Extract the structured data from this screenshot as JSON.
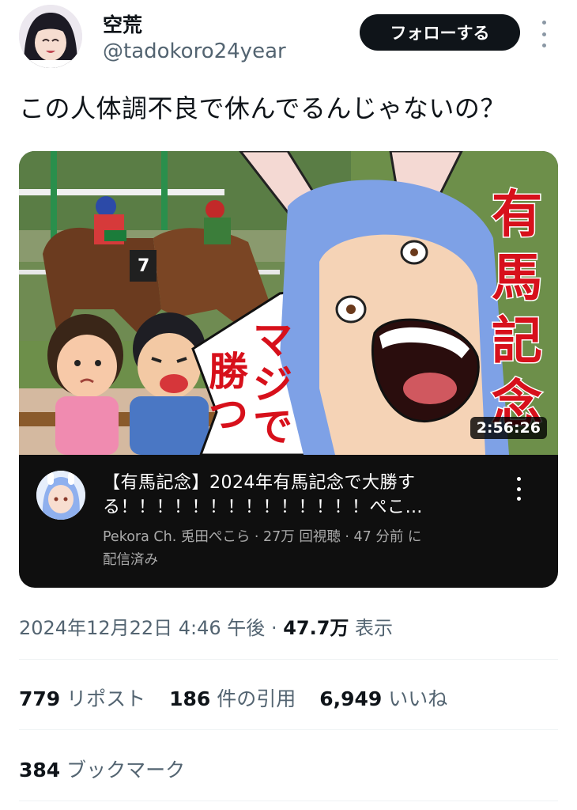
{
  "author": {
    "display_name": "空荒",
    "handle": "@tadokoro24year",
    "follow_label": "フォローする"
  },
  "tweet": {
    "text": "この人体調不良で休んでるんじゃないの？"
  },
  "video_card": {
    "thumbnail_text_right": [
      "有",
      "馬",
      "記",
      "念"
    ],
    "thumbnail_text_bubble_a": [
      "マ",
      "ジ"
    ],
    "thumbnail_text_bubble_b": [
      "で",
      "勝",
      "つ"
    ],
    "jockey_number": "7",
    "duration": "2:56:26",
    "title_line1": "【有馬記念】2024年有馬記念で大勝す",
    "title_line2": "る！！！！！！！！！！！！！！ぺこ…",
    "meta_line1": "Pekora Ch. 兎田ぺこら · 27万 回視聴 · 47 分前 に",
    "meta_line2": "配信済み"
  },
  "timestamp": {
    "datetime": "2024年12月22日 4:46 午後",
    "separator": " · ",
    "views": "47.7万",
    "views_label": " 表示"
  },
  "stats": {
    "reposts": "779",
    "reposts_label": " リポスト",
    "quotes": "186",
    "quotes_label": " 件の引用",
    "likes": "6,949",
    "likes_label": " いいね",
    "bookmarks": "384",
    "bookmarks_label": " ブックマーク"
  },
  "colors": {
    "follow_bg": "#0f1419",
    "secondary_text": "#536471",
    "card_bg": "#0f0f0f",
    "thumbnail_red": "#d7101b"
  }
}
